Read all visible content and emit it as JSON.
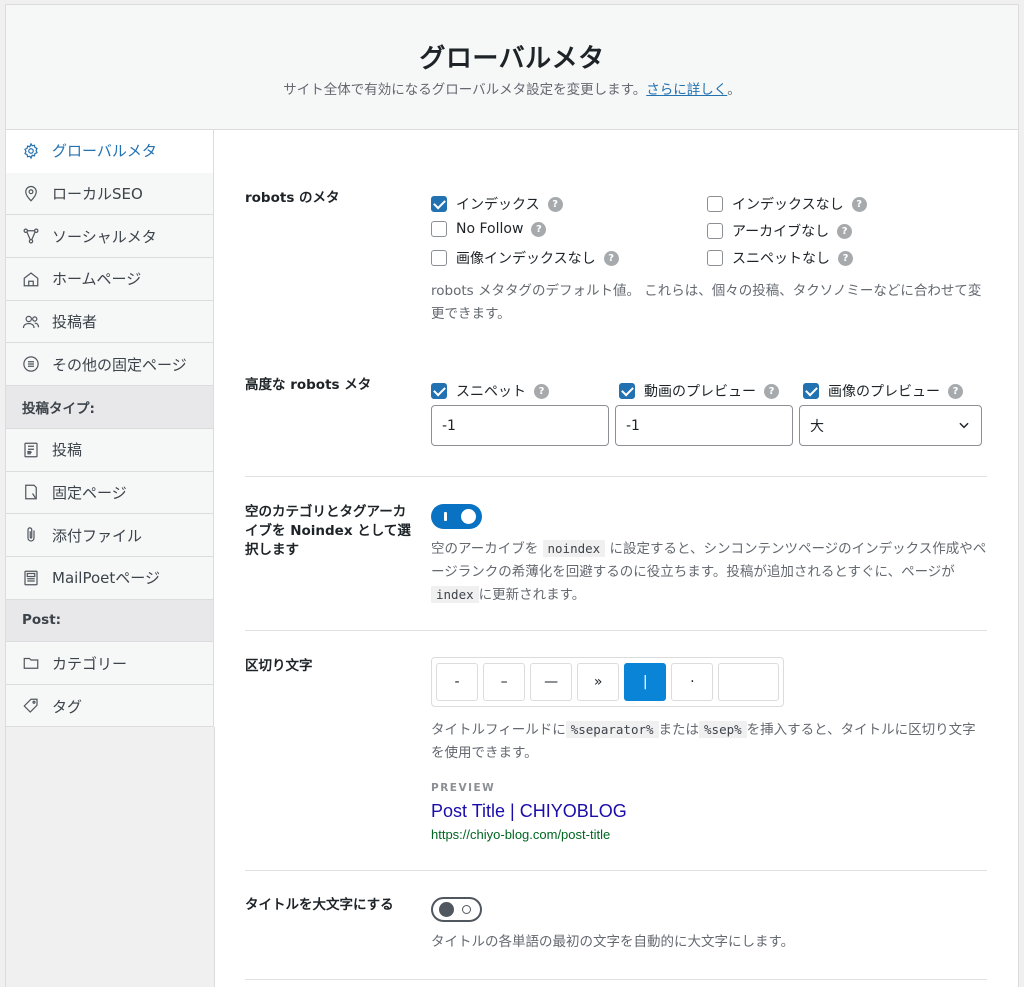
{
  "header": {
    "title": "グローバルメタ",
    "subtitle": "サイト全体で有効になるグローバルメタ設定を変更します。",
    "link": "さらに詳しく",
    "period": "。"
  },
  "sidebar": {
    "items": [
      {
        "label": "グローバルメタ",
        "icon": "gear-icon",
        "active": true
      },
      {
        "label": "ローカルSEO",
        "icon": "location-pin-icon"
      },
      {
        "label": "ソーシャルメタ",
        "icon": "share-nodes-icon"
      },
      {
        "label": "ホームページ",
        "icon": "home-icon"
      },
      {
        "label": "投稿者",
        "icon": "users-icon"
      },
      {
        "label": "その他の固定ページ",
        "icon": "list-circle-icon"
      }
    ],
    "post_types_head": "投稿タイプ:",
    "post_types": [
      {
        "label": "投稿",
        "icon": "document-icon"
      },
      {
        "label": "固定ページ",
        "icon": "page-icon"
      },
      {
        "label": "添付ファイル",
        "icon": "paperclip-icon"
      },
      {
        "label": "MailPoetページ",
        "icon": "newsletter-icon"
      }
    ],
    "taxonomy_head": "Post:",
    "taxonomies": [
      {
        "label": "カテゴリー",
        "icon": "folder-icon"
      },
      {
        "label": "タグ",
        "icon": "tag-icon"
      }
    ]
  },
  "robots": {
    "label": "robots のメタ",
    "options": [
      {
        "label": "インデックス",
        "checked": true
      },
      {
        "label": "インデックスなし",
        "checked": false
      },
      {
        "label": "No Follow",
        "checked": false
      },
      {
        "label": "アーカイブなし",
        "checked": false
      },
      {
        "label": "画像インデックスなし",
        "checked": false
      },
      {
        "label": "スニペットなし",
        "checked": false
      }
    ],
    "description": "robots メタタグのデフォルト値。 これらは、個々の投稿、タクソノミーなどに合わせて変更できます。"
  },
  "advanced": {
    "label": "高度な robots メタ",
    "snippet": {
      "label": "スニペット",
      "checked": true,
      "value": "-1"
    },
    "video": {
      "label": "動画のプレビュー",
      "checked": true,
      "value": "-1"
    },
    "image": {
      "label": "画像のプレビュー",
      "checked": true,
      "value": "大"
    }
  },
  "noindex": {
    "label": "空のカテゴリとタグアーカイブを Noindex として選択します",
    "enabled": true,
    "desc_a": "空のアーカイブを",
    "code1": "noindex",
    "desc_b": "に設定すると、シンコンテンツページのインデックス作成やページランクの希薄化を回避するのに役立ちます。投稿が追加されるとすぐに、ページが",
    "code2": "index",
    "desc_c": "に更新されます。"
  },
  "separator": {
    "label": "区切り文字",
    "options": [
      "-",
      "–",
      "—",
      "»",
      "|",
      "·"
    ],
    "active_index": 4,
    "desc_a": "タイトルフィールドに",
    "code1": "%separator%",
    "desc_b": "または",
    "code2": "%sep%",
    "desc_c": "を挿入すると、タイトルに区切り文字を使用できます。",
    "preview_label": "PREVIEW",
    "preview_title": "Post Title | CHIYOBLOG",
    "preview_url": "https://chiyo-blog.com/post-title"
  },
  "capitalize": {
    "label": "タイトルを大文字にする",
    "enabled": false,
    "description": "タイトルの各単語の最初の文字を自動的に大文字にします。"
  },
  "colors": {
    "accent": "#2271b1",
    "toggle_on": "#0a72c2",
    "link": "#1a0dab",
    "url": "#006621"
  }
}
